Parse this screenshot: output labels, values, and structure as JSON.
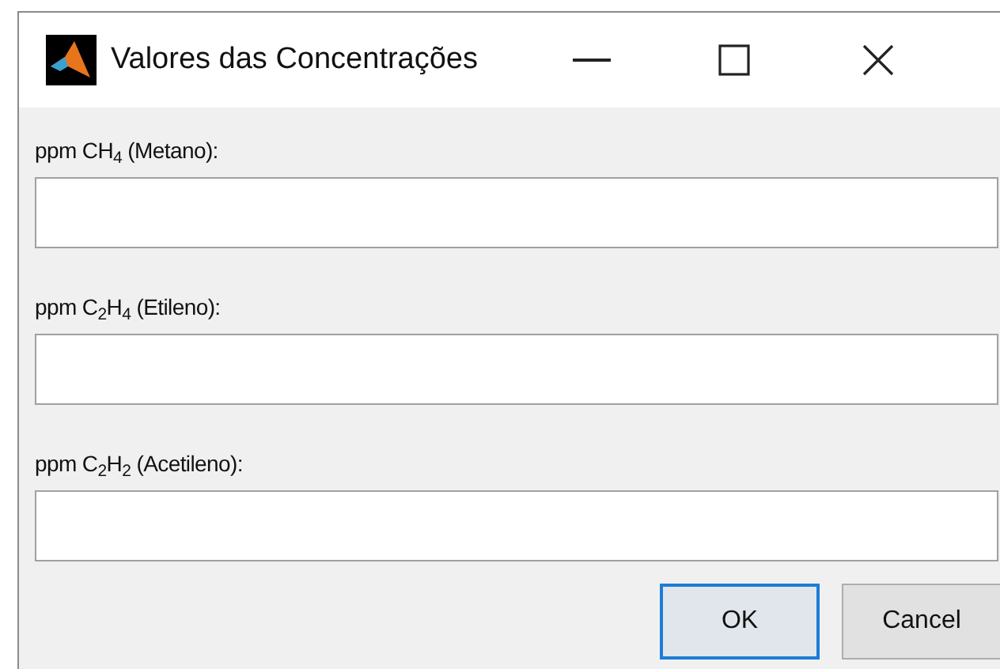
{
  "window": {
    "title": "Valores das Concentrações"
  },
  "fields": [
    {
      "label": "ppm CH$_{4}$ (Metano):"
    },
    {
      "label": "ppm C$_{2}$H$_{4}$ (Etileno):"
    },
    {
      "label": "ppm C$_{2}$H$_{2}$ (Acetileno):"
    }
  ],
  "buttons": [
    {
      "label": "OK",
      "focused": true
    },
    {
      "label": "Cancel",
      "focused": false
    }
  ]
}
